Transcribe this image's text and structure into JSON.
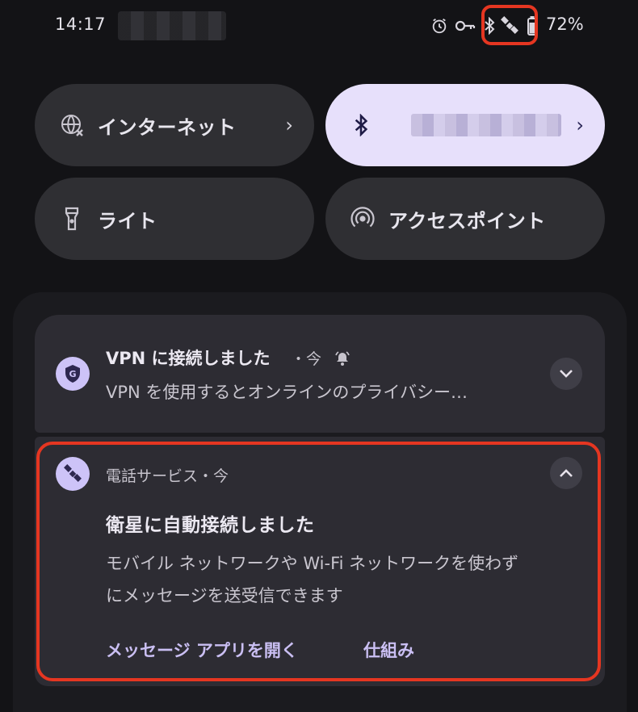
{
  "status_bar": {
    "time": "14:17",
    "battery_percent": "72%",
    "icons": [
      "alarm-icon",
      "vpn-key-icon",
      "bluetooth-icon",
      "satellite-icon",
      "battery-icon"
    ],
    "highlight_color": "#e53621"
  },
  "quick_settings": {
    "tiles": [
      {
        "label": "インターネット",
        "icon": "internet-globe-icon",
        "state": "off"
      },
      {
        "label": "",
        "icon": "bluetooth-icon",
        "state": "on"
      },
      {
        "label": "ライト",
        "icon": "flashlight-icon",
        "state": "off"
      },
      {
        "label": "アクセスポイント",
        "icon": "hotspot-icon",
        "state": "off"
      }
    ]
  },
  "notifications": [
    {
      "icon": "vpn-shield-icon",
      "title": "VPN に接続しました",
      "meta": "・今",
      "text": "VPN を使用するとオンラインのプライバシー…",
      "expanded": false
    },
    {
      "icon": "satellite-icon",
      "app": "電話サービス・今",
      "title": "衛星に自動接続しました",
      "body_line1": "モバイル ネットワークや Wi-Fi ネットワークを使わず",
      "body_line2": "にメッセージを送受信できます",
      "actions": [
        "メッセージ アプリを開く",
        "仕組み"
      ],
      "expanded": true
    }
  ],
  "colors": {
    "background": "#131316",
    "tile_dark": "#2f2f33",
    "tile_active": "#e7e0fb",
    "card": "#2d2c33",
    "accent_text": "#cabff3"
  }
}
